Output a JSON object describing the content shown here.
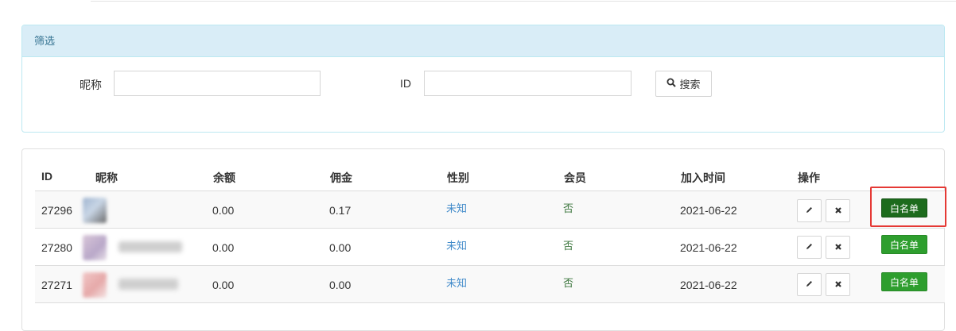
{
  "filter": {
    "title": "筛选",
    "nickname_label": "昵称",
    "nickname_value": "",
    "id_label": "ID",
    "id_value": "",
    "search_label": "搜索"
  },
  "table": {
    "headers": [
      "ID",
      "昵称",
      "余额",
      "佣金",
      "性别",
      "会员",
      "加入时间",
      "操作"
    ],
    "rows": [
      {
        "id": "27296",
        "balance": "0.00",
        "commission": "0.17",
        "gender": "未知",
        "member": "否",
        "join_date": "2021-06-22",
        "whitelist_label": "白名单"
      },
      {
        "id": "27280",
        "balance": "0.00",
        "commission": "0.00",
        "gender": "未知",
        "member": "否",
        "join_date": "2021-06-22",
        "whitelist_label": "白名单"
      },
      {
        "id": "27271",
        "balance": "0.00",
        "commission": "0.00",
        "gender": "未知",
        "member": "否",
        "join_date": "2021-06-22",
        "whitelist_label": "白名单"
      }
    ]
  },
  "colors": {
    "panel_header_bg": "#d9edf7",
    "panel_border": "#bce8f1",
    "gender_text": "#428bca",
    "member_text": "#3c763d",
    "whitelist_btn": "#2e9e2e",
    "whitelist_btn_active": "#1d6b1d",
    "highlight": "#e53935"
  },
  "icons": {
    "search": "search-icon",
    "edit": "pencil-icon",
    "delete": "close-icon"
  }
}
